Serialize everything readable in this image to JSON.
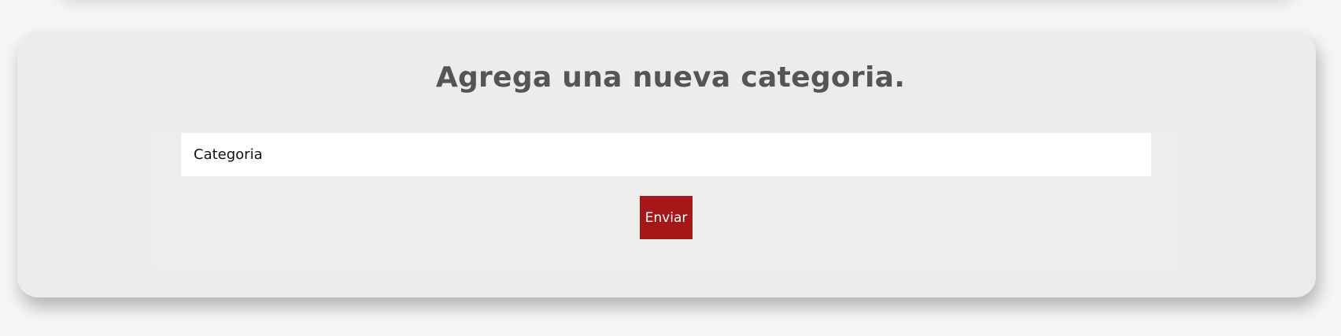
{
  "form": {
    "title": "Agrega una nueva categoria.",
    "category_input": {
      "value": "",
      "placeholder": "Categoria"
    },
    "submit_label": "Enviar"
  },
  "colors": {
    "background": "#f7f6f5",
    "card": "#edebeb",
    "title_text": "#555555",
    "button": "#a51719",
    "button_text": "#ffffff"
  }
}
